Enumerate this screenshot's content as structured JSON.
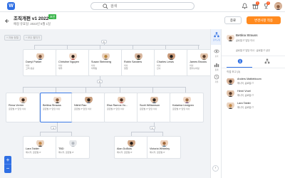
{
  "search": {
    "placeholder": "검색"
  },
  "header": {
    "title": "조직개편 v1 2022",
    "tag": "초안",
    "subtitle": "예정 유효일: 2022년 5월 1일",
    "cancel_label": "종료",
    "primary_label": "변경사항 적용"
  },
  "toolbar": {
    "btn1": "+ 자동 정렬",
    "btn2": "+ 모두 펼치기"
  },
  "canvas": {
    "root_count": "6",
    "level2_count": "6",
    "level3_count": "4",
    "level3b_count": "1",
    "zoom_in": "+",
    "zoom_out": "−"
  },
  "level1": [
    {
      "name": "Darryl Parker",
      "role": "이사",
      "role2": "고객 성공"
    },
    {
      "name": "Christine Nguyen",
      "role": "이사",
      "role2": "재무"
    },
    {
      "name": "Susan Steinberg",
      "role": "이사",
      "role2": "마케팅"
    },
    {
      "name": "Robin Sanders",
      "role": "이사",
      "role2": "영업"
    },
    {
      "name": "Charles Lewis",
      "role": "이사",
      "role2": "인사"
    },
    {
      "name": "James Brooks",
      "role": "이사",
      "role2": "엔지니어링"
    }
  ],
  "level2": [
    {
      "name": "Rena Verrier",
      "role": "글로벌 IT 담당 이사"
    },
    {
      "name": "Bettina Strauss",
      "role": "글로벌 IT 담당 이사"
    },
    {
      "name": "Nikhil Rao",
      "role": "글로벌 IT 담당 이사"
    },
    {
      "name": "Elsa Ramos Vo...",
      "role": "글로벌 IT 담당 이사"
    },
    {
      "name": "Scott Williamson",
      "role": "글로벌 IT 담당 이사"
    },
    {
      "name": "Katarina Lindgren",
      "role": "글로벌 IT 담당 이사"
    }
  ],
  "level3": [
    {
      "name": "Lara Tabler",
      "role": "매니저, 글로벌 IT"
    },
    {
      "name": "TBD",
      "role": "매니저, 글로벌 IT"
    },
    {
      "name": "Alan DuBois",
      "role": "매니저, 글로벌 IT"
    },
    {
      "name": "Victoria Whiteley",
      "role": "매니저, 글로벌 IT"
    }
  ],
  "rail": [
    {
      "label": "조직 구조"
    },
    {
      "label": "보기"
    },
    {
      "label": "통계"
    },
    {
      "label": "기록"
    }
  ],
  "panel": {
    "name": "Bettina Strauss",
    "role": "글로벌 IT 담당 이사",
    "role2": "글로벌 IT 담당 이사 · 글로벌 IT 상무",
    "section": "직접 보고 (3)",
    "reports": [
      {
        "name": "Anders Mattlebloom",
        "role": "매니저, 글로벌 IT"
      },
      {
        "name": "Henri Vroel",
        "role": "매니저, 글로벌 IT"
      },
      {
        "name": "Lara Tabler",
        "role": "매니저, 글로벌 IT"
      }
    ]
  },
  "colors": {
    "accent": "#2f6fe4",
    "primary_button": "#ff8a1f",
    "tag": "#39b54a"
  }
}
